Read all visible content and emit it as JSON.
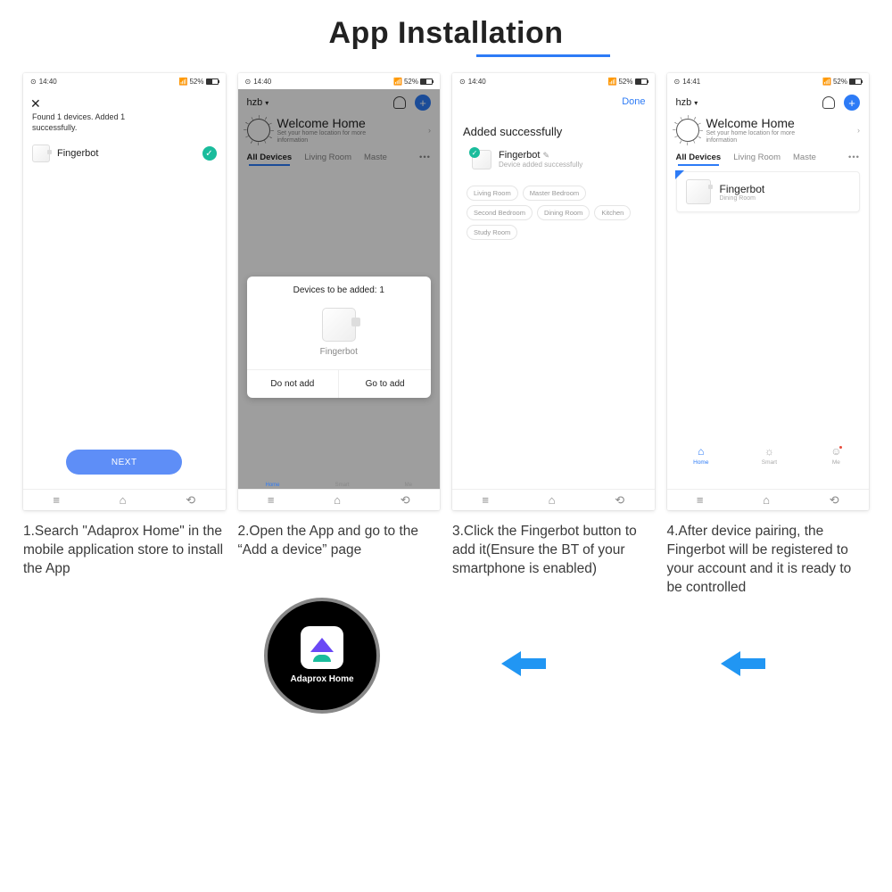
{
  "title": "App Installation",
  "status": {
    "time1": "14:40",
    "time2": "14:41",
    "battery": "52%"
  },
  "screen1": {
    "found_text": "Found 1 devices. Added 1 successfully.",
    "device": "Fingerbot",
    "next": "NEXT"
  },
  "screen2": {
    "account": "hzb",
    "welcome": "Welcome Home",
    "welcome_sub": "Set your home location for more information",
    "tabs": [
      "All Devices",
      "Living Room",
      "Maste"
    ],
    "modal_title": "Devices to be added: 1",
    "modal_device": "Fingerbot",
    "btn_no": "Do not add",
    "btn_go": "Go to add",
    "mini_tabs": [
      "Home",
      "Smart",
      "Me"
    ]
  },
  "screen3": {
    "done": "Done",
    "title": "Added successfully",
    "device": "Fingerbot",
    "sub": "Device added successfully",
    "rooms": [
      "Living Room",
      "Master Bedroom",
      "Second Bedroom",
      "Dining Room",
      "Kitchen",
      "Study Room"
    ]
  },
  "screen4": {
    "account": "hzb",
    "welcome": "Welcome Home",
    "welcome_sub": "Set your home location for more information",
    "tabs": [
      "All Devices",
      "Living Room",
      "Maste"
    ],
    "card_name": "Fingerbot",
    "card_room": "Dining Room",
    "bottom_tabs": [
      "Home",
      "Smart",
      "Me"
    ]
  },
  "captions": {
    "c1": "1.Search \"Adaprox Home\" in the mobile application store to install the App",
    "c2": "2.Open the App and go to the “Add a device” page",
    "c3": "3.Click the Fingerbot button to add it(Ensure the BT of your smartphone is enabled)",
    "c4": "4.After device pairing, the Fingerbot will be registered to your account and it is ready to be controlled"
  },
  "app_label": "Adaprox Home"
}
